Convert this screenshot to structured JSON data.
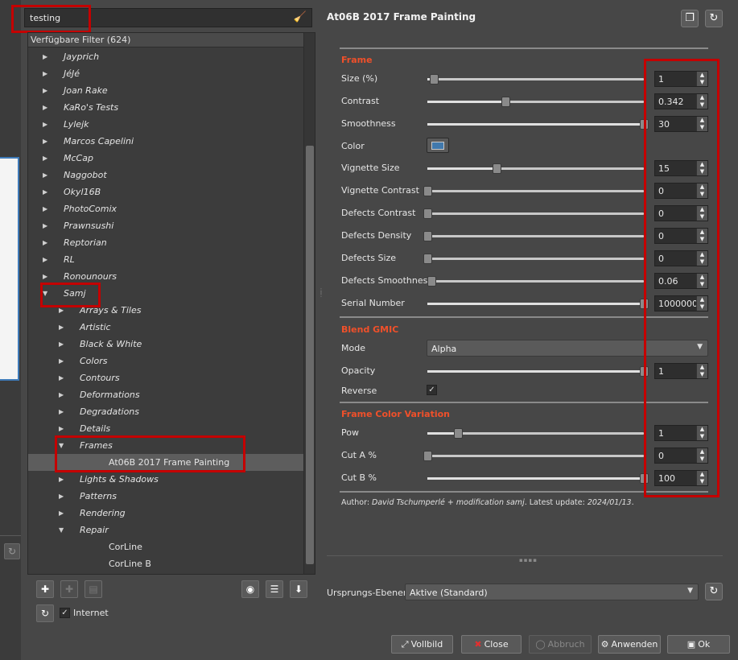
{
  "search": {
    "value": "testing"
  },
  "filter_tree": {
    "header": "Verfügbare Filter (624)",
    "rows": [
      {
        "label": "Jayprich",
        "level": 0,
        "expanded": false
      },
      {
        "label": "JéJé",
        "level": 0,
        "expanded": false
      },
      {
        "label": "Joan Rake",
        "level": 0,
        "expanded": false
      },
      {
        "label": "KaRo's Tests",
        "level": 0,
        "expanded": false
      },
      {
        "label": "Lylejk",
        "level": 0,
        "expanded": false
      },
      {
        "label": "Marcos Capelini",
        "level": 0,
        "expanded": false
      },
      {
        "label": "McCap",
        "level": 0,
        "expanded": false
      },
      {
        "label": "Naggobot",
        "level": 0,
        "expanded": false
      },
      {
        "label": "Okyl16B",
        "level": 0,
        "expanded": false
      },
      {
        "label": "PhotoComix",
        "level": 0,
        "expanded": false
      },
      {
        "label": "Prawnsushi",
        "level": 0,
        "expanded": false
      },
      {
        "label": "Reptorian",
        "level": 0,
        "expanded": false
      },
      {
        "label": "RL",
        "level": 0,
        "expanded": false
      },
      {
        "label": "Ronounours",
        "level": 0,
        "expanded": false
      },
      {
        "label": "Samj",
        "level": 0,
        "expanded": true
      },
      {
        "label": "Arrays & Tiles",
        "level": 1,
        "expanded": false
      },
      {
        "label": "Artistic",
        "level": 1,
        "expanded": false
      },
      {
        "label": "Black & White",
        "level": 1,
        "expanded": false
      },
      {
        "label": "Colors",
        "level": 1,
        "expanded": false
      },
      {
        "label": "Contours",
        "level": 1,
        "expanded": false
      },
      {
        "label": "Deformations",
        "level": 1,
        "expanded": false
      },
      {
        "label": "Degradations",
        "level": 1,
        "expanded": false
      },
      {
        "label": "Details",
        "level": 1,
        "expanded": false
      },
      {
        "label": "Frames",
        "level": 1,
        "expanded": true
      },
      {
        "label": "At06B 2017 Frame Painting",
        "level": 2,
        "leaf": true,
        "selected": true
      },
      {
        "label": "Lights & Shadows",
        "level": 1,
        "expanded": false
      },
      {
        "label": "Patterns",
        "level": 1,
        "expanded": false
      },
      {
        "label": "Rendering",
        "level": 1,
        "expanded": false
      },
      {
        "label": "Repair",
        "level": 1,
        "expanded": true
      },
      {
        "label": "CorLine",
        "level": 2,
        "leaf": true
      },
      {
        "label": "CorLine B",
        "level": 2,
        "leaf": true
      }
    ]
  },
  "internet": {
    "label": "Internet",
    "checked": true
  },
  "filter_title": "At06B 2017 Frame Painting",
  "sections": {
    "frame": "Frame",
    "blend": "Blend GMIC",
    "variation": "Frame Color Variation"
  },
  "params": [
    {
      "label": "Size (%)",
      "value": "1",
      "fraction": 0.03
    },
    {
      "label": "Contrast",
      "value": "0.342",
      "fraction": 0.36
    },
    {
      "label": "Smoothness",
      "value": "30",
      "fraction": 1.0
    },
    {
      "label": "Vignette Size",
      "value": "15",
      "fraction": 0.32
    },
    {
      "label": "Vignette Contrast",
      "value": "0",
      "fraction": 0.0
    },
    {
      "label": "Defects Contrast",
      "value": "0",
      "fraction": 0.0
    },
    {
      "label": "Defects Density",
      "value": "0",
      "fraction": 0.0
    },
    {
      "label": "Defects Size",
      "value": "0",
      "fraction": 0.0
    },
    {
      "label": "Defects Smoothness",
      "value": "0.06",
      "fraction": 0.02
    },
    {
      "label": "Serial Number",
      "value": "1000000",
      "fraction": 1.0
    },
    {
      "label": "Opacity",
      "value": "1",
      "fraction": 1.0
    },
    {
      "label": "Pow",
      "value": "1",
      "fraction": 0.14
    },
    {
      "label": "Cut A %",
      "value": "0",
      "fraction": 0.0
    },
    {
      "label": "Cut B %",
      "value": "100",
      "fraction": 1.0
    }
  ],
  "color": {
    "label": "Color",
    "value": "#4179ad"
  },
  "mode": {
    "label": "Mode",
    "value": "Alpha"
  },
  "reverse": {
    "label": "Reverse",
    "checked": true
  },
  "author": {
    "prefix": "Author: ",
    "name": "David Tschumperlé + modification samj",
    "mid": ". Latest update: ",
    "date": "2024/01/13",
    "suffix": "."
  },
  "layers": {
    "label": "Ursprungs-Ebenen",
    "value": "Aktive (Standard)"
  },
  "buttons": {
    "fullscreen": "Vollbild",
    "close": "Close",
    "cancel": "Abbruch",
    "apply": "Anwenden",
    "ok": "Ok"
  },
  "colors": {
    "accent": "#f0502a",
    "highlight": "#c40000",
    "selection": "#5d5d5d"
  }
}
